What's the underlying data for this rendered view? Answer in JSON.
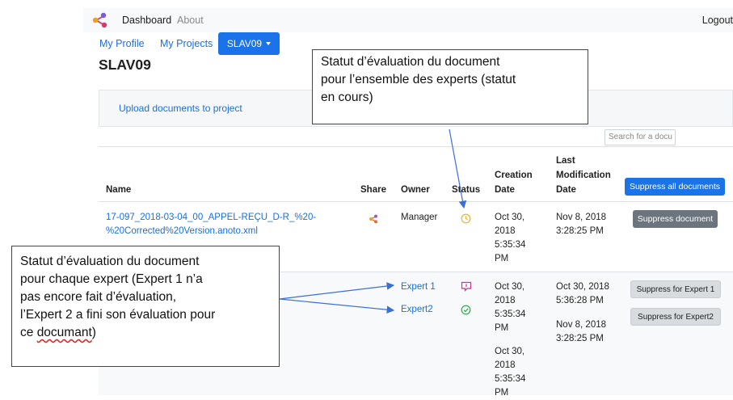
{
  "nav": {
    "dashboard": "Dashboard",
    "about": "About",
    "logout": "Logout"
  },
  "subnav": {
    "my_profile": "My Profile",
    "my_projects": "My Projects",
    "project_button": "SLAV09"
  },
  "project_title": "SLAV09",
  "upload_link": "Upload documents to project",
  "search": {
    "placeholder": "Search for a docu"
  },
  "table": {
    "headers": {
      "name": "Name",
      "share": "Share",
      "owner": "Owner",
      "status": "Status",
      "creation_1": "Creation",
      "creation_2": "Date",
      "lastmod_1": "Last",
      "lastmod_2": "Modification",
      "lastmod_3": "Date"
    },
    "suppress_all": "Suppress all documents",
    "row1": {
      "name_line1": "17-097_2018-03-04_00_APPEL-REÇU_D-R_%20-",
      "name_line2": "%20Corrected%20Version.anoto.xml",
      "owner": "Manager",
      "creation": [
        "Oct 30,",
        "2018",
        "5:35:34",
        "PM"
      ],
      "lastmod": [
        "Nov 8, 2018",
        "3:28:25 PM"
      ],
      "action": "Suppress document"
    },
    "row2": {
      "experts": [
        "Expert 1",
        "Expert2"
      ],
      "creation_a": [
        "Oct 30,",
        "2018",
        "5:35:34",
        "PM"
      ],
      "creation_b": [
        "Oct 30,",
        "2018",
        "5:35:34",
        "PM"
      ],
      "lastmod_a": [
        "Oct 30, 2018",
        "5:36:28 PM"
      ],
      "lastmod_b": [
        "Nov 8, 2018",
        "3:28:25 PM"
      ],
      "actions": [
        "Suppress for Expert 1",
        "Suppress for Expert2"
      ]
    }
  },
  "annotations": {
    "top": [
      "Statut d’évaluation du document",
      "pour l’ensemble des experts (statut",
      "en cours)"
    ],
    "left": [
      "Statut d’évaluation du document",
      "pour chaque expert (Expert 1 n’a",
      "pas encore fait d’évaluation,",
      "l’Expert 2 a fini son évaluation pour",
      "ce ",
      "documant",
      ")"
    ]
  },
  "colors": {
    "primary": "#1a73e8",
    "link": "#1a6fe0",
    "status_in_progress": "#f0b400",
    "status_not_started": "#c2379b",
    "status_done": "#28a745",
    "share_icon": "#e0703a"
  }
}
